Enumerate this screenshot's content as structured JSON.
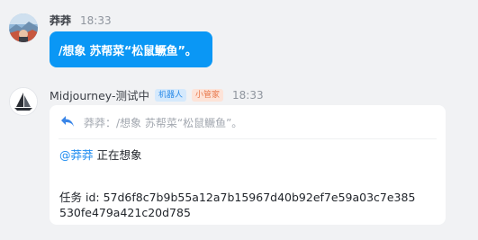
{
  "messages": [
    {
      "sender": "莽莽",
      "time": "18:33",
      "text": "/想象 苏帮菜“松鼠鳜鱼”。"
    },
    {
      "sender": "Midjourney-测试中",
      "badges": [
        "机器人",
        "小管家"
      ],
      "time": "18:33",
      "reply_quote": "莽莽：/想象 苏帮菜“松鼠鳜鱼”。",
      "mention": "@莽莽",
      "status_text": " 正在想象",
      "task_label": "任务 id: ",
      "task_id_part1": "57d6f8c7b9b55a12a7b15967d40b92ef7e59a03c7e385",
      "task_id_part2": "530fe479a421c20d785"
    }
  ],
  "colors": {
    "background": "#f1f2f4",
    "user_bubble": "#0a97f5",
    "mention": "#1f8cf0",
    "reply_icon": "#3a86e8",
    "badge_bot": "#2b8be8",
    "badge_helper": "#e8774a"
  },
  "icons": {
    "user_avatar": "landscape-photo-avatar",
    "bot_avatar": "sailboat-logo-avatar",
    "reply": "reply-arrow-icon"
  }
}
